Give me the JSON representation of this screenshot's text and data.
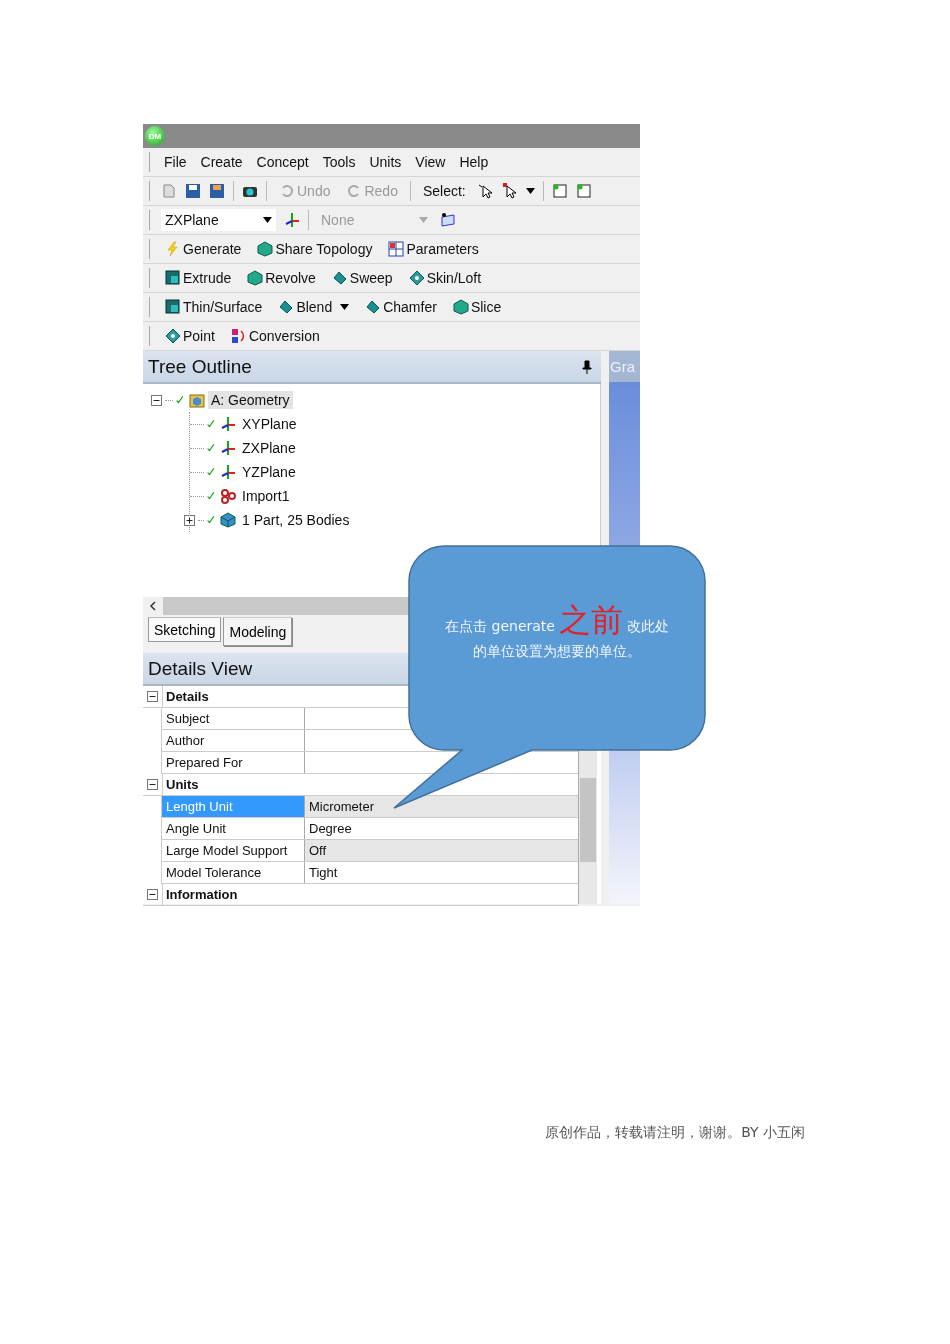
{
  "window": {
    "logo": "DM"
  },
  "menu": [
    "File",
    "Create",
    "Concept",
    "Tools",
    "Units",
    "View",
    "Help"
  ],
  "toolbar": {
    "undo": {
      "label": "Undo",
      "disabled": true
    },
    "redo": {
      "label": "Redo",
      "disabled": true
    },
    "select_label": "Select:"
  },
  "plane_bar": {
    "plane": "ZXPlane",
    "sketch": "None",
    "sketch_disabled": true
  },
  "feature_rows": [
    {
      "items": [
        {
          "label": "Generate",
          "dropdown": false
        },
        {
          "label": "Share Topology",
          "dropdown": false
        },
        {
          "label": "Parameters",
          "dropdown": false
        }
      ]
    },
    {
      "items": [
        {
          "label": "Extrude",
          "dropdown": false
        },
        {
          "label": "Revolve",
          "dropdown": false
        },
        {
          "label": "Sweep",
          "dropdown": false
        },
        {
          "label": "Skin/Loft",
          "dropdown": false
        }
      ]
    },
    {
      "items": [
        {
          "label": "Thin/Surface",
          "dropdown": false
        },
        {
          "label": "Blend",
          "dropdown": true
        },
        {
          "label": "Chamfer",
          "dropdown": false
        },
        {
          "label": "Slice",
          "dropdown": false
        }
      ]
    },
    {
      "items": [
        {
          "label": "Point",
          "dropdown": false
        },
        {
          "label": "Conversion",
          "dropdown": false
        }
      ]
    }
  ],
  "tree_outline": {
    "title": "Tree Outline",
    "root": {
      "label": "A: Geometry",
      "selected": true,
      "expanded": true,
      "children": [
        {
          "label": "XYPlane",
          "kind": "plane",
          "selected": false
        },
        {
          "label": "ZXPlane",
          "kind": "plane",
          "selected": false
        },
        {
          "label": "YZPlane",
          "kind": "plane",
          "selected": false
        },
        {
          "label": "Import1",
          "kind": "import",
          "selected": false
        },
        {
          "label": "1 Part, 25 Bodies",
          "kind": "part",
          "selected": false,
          "expanded": false
        }
      ]
    }
  },
  "mode_tabs": [
    {
      "label": "Sketching",
      "selected": false
    },
    {
      "label": "Modeling",
      "selected": true
    }
  ],
  "graphics": {
    "title": "Gra"
  },
  "details_view": {
    "title": "Details View",
    "groups": [
      {
        "title": "Details",
        "expanded": true,
        "rows": [
          {
            "name": "Subject",
            "value": null,
            "selected": false
          },
          {
            "name": "Author",
            "value": null,
            "selected": false
          },
          {
            "name": "Prepared For",
            "value": null,
            "selected": false
          }
        ]
      },
      {
        "title": "Units",
        "expanded": true,
        "rows": [
          {
            "name": "Length Unit",
            "value": "Micrometer",
            "selected": true
          },
          {
            "name": "Angle Unit",
            "value": "Degree",
            "selected": false
          },
          {
            "name": "Large Model Support",
            "value": "Off",
            "selected": false
          },
          {
            "name": "Model Tolerance",
            "value": "Tight",
            "selected": false
          }
        ]
      },
      {
        "title": "Information",
        "expanded": true
      }
    ]
  },
  "callout": {
    "text_before": "在点击 generate",
    "emphasis": "之前",
    "text_after": "改此处",
    "second_line": "的单位设置为想要的单位。"
  },
  "caption": "原创作品，转载请注明，谢谢。BY 小五闲"
}
